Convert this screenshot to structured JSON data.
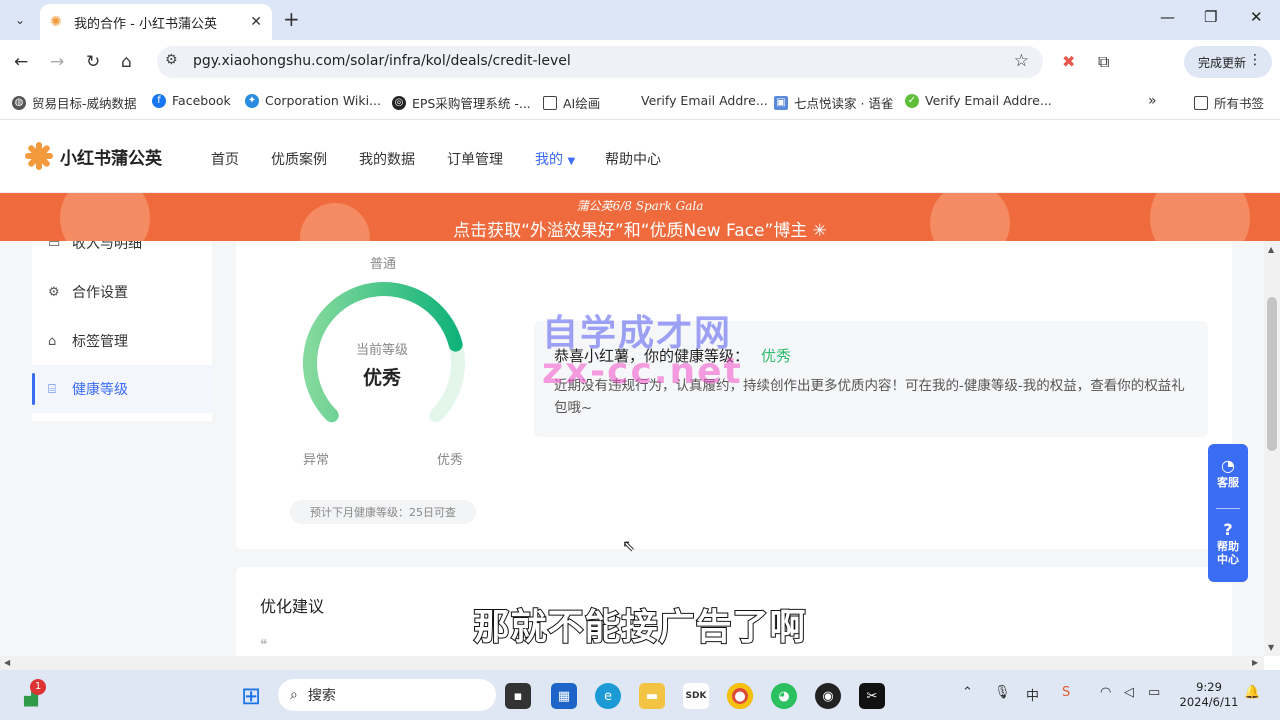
{
  "browser": {
    "tab_title": "我的合作 - 小红书蒲公英",
    "url": "pgy.xiaohongshu.com/solar/infra/kol/deals/credit-level",
    "update_label": "完成更新",
    "bookmarks": [
      {
        "label": "贸易目标-威纳数据",
        "icon": "globe-icon"
      },
      {
        "label": "Facebook",
        "icon": "facebook-icon"
      },
      {
        "label": "Corporation Wiki...",
        "icon": "network-icon"
      },
      {
        "label": "EPS采购管理系统 -...",
        "icon": "eps-icon"
      },
      {
        "label": "AI绘画",
        "icon": "folder-icon"
      },
      {
        "label": "Verify Email Addre...",
        "icon": "none"
      },
      {
        "label": "七点悦读家 · 语雀",
        "icon": "yuque-icon"
      },
      {
        "label": "Verify Email Addre...",
        "icon": "check-icon"
      }
    ],
    "all_bookmarks": "所有书签"
  },
  "site": {
    "logo_text": "小红书蒲公英",
    "nav": [
      "首页",
      "优质案例",
      "我的数据",
      "订单管理",
      "我的",
      "帮助中心"
    ],
    "banner_line1": "蒲公英6/8 Spark Gala",
    "banner_line2": "点击获取“外溢效果好”和“优质New Face”博主"
  },
  "sidebar": {
    "items": [
      {
        "label": "收入与明细",
        "icon": "wallet-icon"
      },
      {
        "label": "合作设置",
        "icon": "gear-icon"
      },
      {
        "label": "标签管理",
        "icon": "tag-icon"
      },
      {
        "label": "健康等级",
        "icon": "health-icon"
      }
    ]
  },
  "health": {
    "label_normal": "普通",
    "label_abnormal": "异常",
    "label_excellent": "优秀",
    "current_label": "当前等级",
    "current_level": "优秀",
    "next_month_note": "预计下月健康等级：25日可查",
    "message_title": "恭喜小红薯，你的健康等级：",
    "message_level": "优秀",
    "message_body": "近期没有违规行为，认真履约，持续创作出更多优质内容！可在我的-健康等级-我的权益，查看你的权益礼包哦~",
    "watermark_line1": "自学成才网",
    "watermark_line2": "zx-cc.net",
    "gauge_level": 0.78
  },
  "suggestions": {
    "heading": "优化建议",
    "quote": "❝"
  },
  "float_bar": {
    "service": "客服",
    "help": "帮助中心"
  },
  "subtitle": "那就不能接广告了啊",
  "taskbar": {
    "search_placeholder": "搜索",
    "badge": "1",
    "ime": "中",
    "time": "9:29",
    "date": "2024/6/11"
  }
}
